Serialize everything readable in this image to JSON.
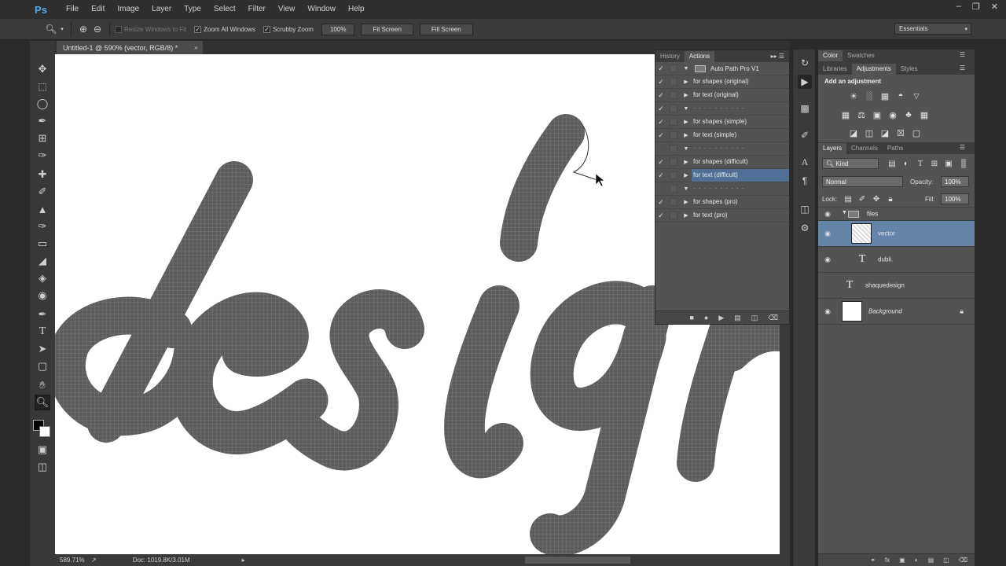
{
  "app": {
    "logo": "Ps",
    "menu": [
      "File",
      "Edit",
      "Image",
      "Layer",
      "Type",
      "Select",
      "Filter",
      "View",
      "Window",
      "Help"
    ],
    "window_controls": [
      "–",
      "❐",
      "✕"
    ]
  },
  "options": {
    "resize_windows": "Resize Windows to Fit",
    "zoom_all": "Zoom All Windows",
    "scrubby_zoom": "Scrubby Zoom",
    "zoom_value": "100%",
    "fit_screen": "Fit Screen",
    "fill_screen": "Fill Screen",
    "workspace": "Essentials"
  },
  "document": {
    "tab_title": "Untitled-1 @ 590% (vector, RGB/8) *",
    "status_zoom": "589.71%",
    "status_doc": "Doc: 1019.8K/3.01M"
  },
  "actions_panel": {
    "tabs": [
      "History",
      "Actions"
    ],
    "set_name": "Auto Path Pro V1",
    "items": [
      {
        "checked": true,
        "name": "for shapes (original)",
        "type": "action"
      },
      {
        "checked": true,
        "name": "for text (original)",
        "type": "action"
      },
      {
        "checked": true,
        "name": "· · · · · · · · · ·",
        "type": "divider"
      },
      {
        "checked": true,
        "name": "for shapes (simple)",
        "type": "action"
      },
      {
        "checked": true,
        "name": "for text (simple)",
        "type": "action"
      },
      {
        "checked": false,
        "name": "· · · · · · · · · ·",
        "type": "divider"
      },
      {
        "checked": true,
        "name": "for shapes (difficult)",
        "type": "action"
      },
      {
        "checked": true,
        "name": "for text (difficult)",
        "type": "action",
        "selected": true
      },
      {
        "checked": false,
        "name": "· · · · · · · · · ·",
        "type": "divider"
      },
      {
        "checked": true,
        "name": "for shapes (pro)",
        "type": "action"
      },
      {
        "checked": true,
        "name": "for text (pro)",
        "type": "action"
      }
    ]
  },
  "color_panel": {
    "tabs": [
      "Color",
      "Swatches"
    ]
  },
  "adjust_panel": {
    "tabs": [
      "Libraries",
      "Adjustments",
      "Styles"
    ],
    "title": "Add an adjustment"
  },
  "layers_panel": {
    "tabs": [
      "Layers",
      "Channels",
      "Paths"
    ],
    "kind": "Kind",
    "blend_mode": "Normal",
    "opacity_label": "Opacity:",
    "opacity_value": "100%",
    "lock_label": "Lock:",
    "fill_label": "Fill:",
    "fill_value": "100%",
    "layers": [
      {
        "name": "files",
        "type": "group",
        "visible": true
      },
      {
        "name": "vector",
        "type": "smart",
        "visible": true,
        "selected": true
      },
      {
        "name": "dubli.",
        "type": "text",
        "visible": true
      },
      {
        "name": "shaquedesign",
        "type": "text",
        "visible": false
      },
      {
        "name": "Background",
        "type": "background",
        "visible": true,
        "locked": true
      }
    ]
  }
}
